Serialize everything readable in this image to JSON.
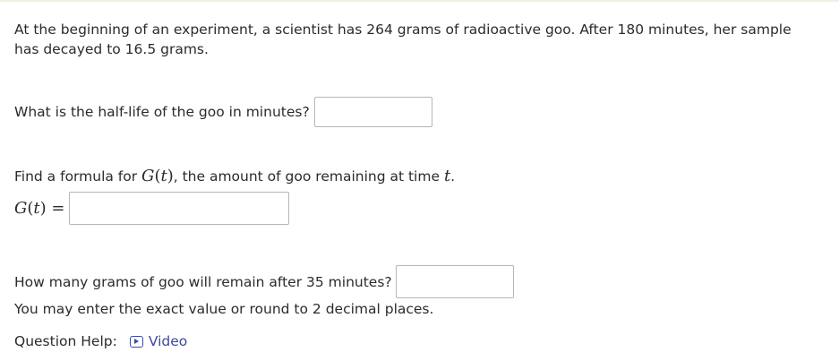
{
  "problem": {
    "intro": "At the beginning of an experiment, a scientist has 264 grams of radioactive goo. After 180 minutes, her sample has decayed to 16.5 grams."
  },
  "question1": {
    "label": "What is the half-life of the goo in minutes?",
    "value": ""
  },
  "question2": {
    "prompt_before": "Find a formula for ",
    "prompt_func": "G",
    "prompt_paren_open": "(",
    "prompt_var": "t",
    "prompt_paren_close": ")",
    "prompt_middle": ", the amount of goo remaining at time ",
    "prompt_time_var": "t",
    "prompt_end": ".",
    "lhs_func": "G",
    "lhs_paren_open": "(",
    "lhs_var": "t",
    "lhs_paren_close": ")",
    "lhs_equals": " =",
    "value": ""
  },
  "question3": {
    "label": "How many grams of goo will remain after 35 minutes?",
    "value": "",
    "note": "You may enter the exact value or round to 2 decimal places."
  },
  "help": {
    "label": "Question Help:",
    "video_label": "Video",
    "video_icon": "play-icon"
  },
  "colors": {
    "link": "#3d4aa0",
    "text": "#2b2b2b",
    "input_border": "#b6b6b6"
  }
}
